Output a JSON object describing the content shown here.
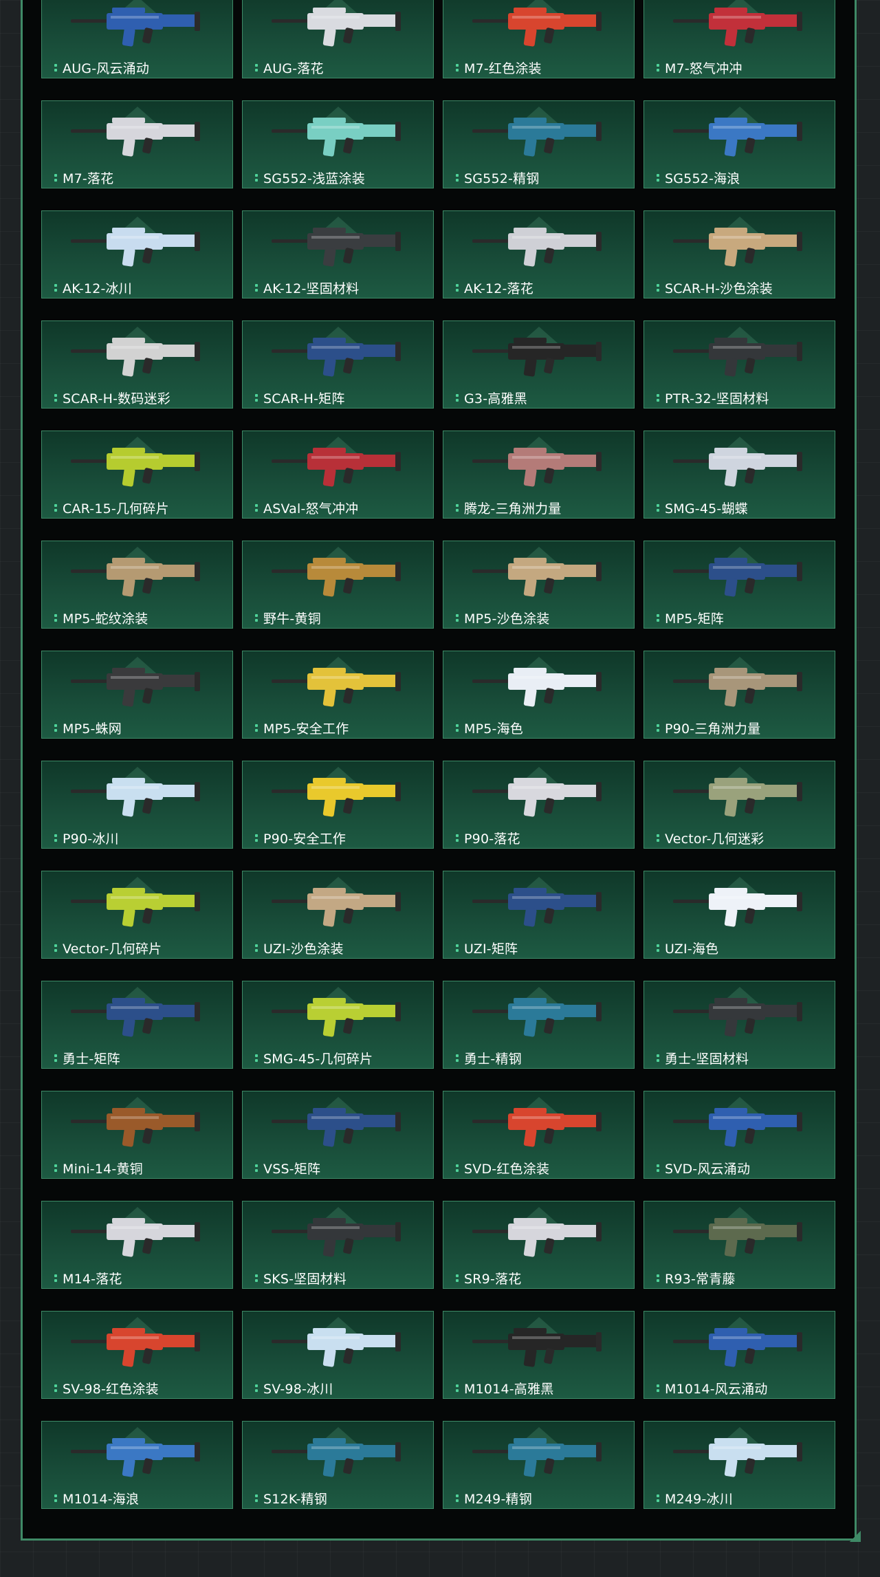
{
  "colors": {
    "page_bg": "#1e2224",
    "panel_bg": "#050707",
    "panel_border": "#3f8a66",
    "card_border": "#3d8b67",
    "label_dots": "#4fd39a",
    "label_text": "#ffffff"
  },
  "weapons": [
    {
      "name": "AUG-风云涌动",
      "color": "#2f5fb0"
    },
    {
      "name": "AUG-落花",
      "color": "#d9dbe0"
    },
    {
      "name": "M7-红色涂装",
      "color": "#d8452e"
    },
    {
      "name": "M7-怒气冲冲",
      "color": "#c2303a"
    },
    {
      "name": "M7-落花",
      "color": "#d6d6dc"
    },
    {
      "name": "SG552-浅蓝涂装",
      "color": "#79cfc3"
    },
    {
      "name": "SG552-精钢",
      "color": "#2b7a99"
    },
    {
      "name": "SG552-海浪",
      "color": "#3b78c4"
    },
    {
      "name": "AK-12-冰川",
      "color": "#c8dcef"
    },
    {
      "name": "AK-12-坚固材料",
      "color": "#3a3d40"
    },
    {
      "name": "AK-12-落花",
      "color": "#cfd0d6"
    },
    {
      "name": "SCAR-H-沙色涂装",
      "color": "#c8a97e"
    },
    {
      "name": "SCAR-H-数码迷彩",
      "color": "#d2d2d2"
    },
    {
      "name": "SCAR-H-矩阵",
      "color": "#2c4f8a"
    },
    {
      "name": "G3-高雅黑",
      "color": "#262626"
    },
    {
      "name": "PTR-32-坚固材料",
      "color": "#34373a"
    },
    {
      "name": "CAR-15-几何碎片",
      "color": "#b6cc2f"
    },
    {
      "name": "ASVal-怒气冲冲",
      "color": "#b83038"
    },
    {
      "name": "腾龙-三角洲力量",
      "color": "#b47b78"
    },
    {
      "name": "SMG-45-蝴蝶",
      "color": "#cfd5df"
    },
    {
      "name": "MP5-蛇纹涂装",
      "color": "#b59a72"
    },
    {
      "name": "野牛-黄铜",
      "color": "#b88a3a"
    },
    {
      "name": "MP5-沙色涂装",
      "color": "#c4a880"
    },
    {
      "name": "MP5-矩阵",
      "color": "#2c4f8a"
    },
    {
      "name": "MP5-蛛网",
      "color": "#3a3a3c"
    },
    {
      "name": "MP5-安全工作",
      "color": "#e3c23a"
    },
    {
      "name": "MP5-海色",
      "color": "#e9eef5"
    },
    {
      "name": "P90-三角洲力量",
      "color": "#a8967a"
    },
    {
      "name": "P90-冰川",
      "color": "#c9dff0"
    },
    {
      "name": "P90-安全工作",
      "color": "#e9c92c"
    },
    {
      "name": "P90-落花",
      "color": "#d8d8de"
    },
    {
      "name": "Vector-几何迷彩",
      "color": "#9aa27c"
    },
    {
      "name": "Vector-几何碎片",
      "color": "#b9cf33"
    },
    {
      "name": "UZI-沙色涂装",
      "color": "#c3a884"
    },
    {
      "name": "UZI-矩阵",
      "color": "#2c4f8a"
    },
    {
      "name": "UZI-海色",
      "color": "#eef2f8"
    },
    {
      "name": "勇士-矩阵",
      "color": "#2c4f8a"
    },
    {
      "name": "SMG-45-几何碎片",
      "color": "#b9cf33"
    },
    {
      "name": "勇士-精钢",
      "color": "#2b7a99"
    },
    {
      "name": "勇士-坚固材料",
      "color": "#35383b"
    },
    {
      "name": "Mini-14-黄铜",
      "color": "#9a5a2a"
    },
    {
      "name": "VSS-矩阵",
      "color": "#2c4f8a"
    },
    {
      "name": "SVD-红色涂装",
      "color": "#d8452e"
    },
    {
      "name": "SVD-风云涌动",
      "color": "#2f5fb0"
    },
    {
      "name": "M14-落花",
      "color": "#d6d6dc"
    },
    {
      "name": "SKS-坚固材料",
      "color": "#34373a"
    },
    {
      "name": "SR9-落花",
      "color": "#d6d6dc"
    },
    {
      "name": "R93-常青藤",
      "color": "#5d6a4e"
    },
    {
      "name": "SV-98-红色涂装",
      "color": "#d8452e"
    },
    {
      "name": "SV-98-冰川",
      "color": "#c9dff0"
    },
    {
      "name": "M1014-高雅黑",
      "color": "#262626"
    },
    {
      "name": "M1014-风云涌动",
      "color": "#2f5fb0"
    },
    {
      "name": "M1014-海浪",
      "color": "#3b78c4"
    },
    {
      "name": "S12K-精钢",
      "color": "#2b7a99"
    },
    {
      "name": "M249-精钢",
      "color": "#2b7a99"
    },
    {
      "name": "M249-冰川",
      "color": "#c9dff0"
    }
  ]
}
